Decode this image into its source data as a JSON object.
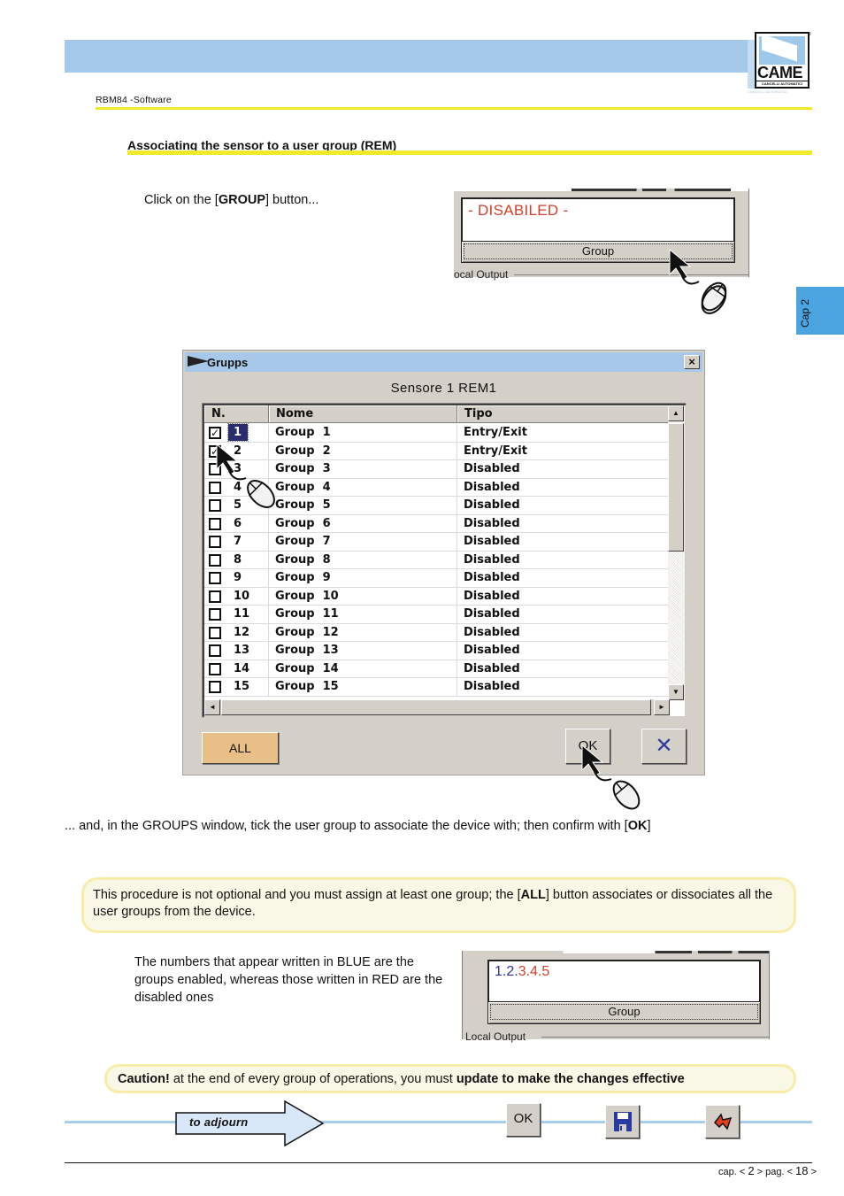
{
  "header": {
    "doc_id": "RBM84 -Software",
    "logo": {
      "brand": "CAME",
      "tagline": "CANCELLI AUTOMATICI",
      "registered": "®"
    },
    "section_title": "Associating the sensor to a user group (REM)",
    "chapter_tab": "Cap 2"
  },
  "step1": {
    "text_before": "Click on the [",
    "bold": "GROUP",
    "text_after": "] button..."
  },
  "panel_disabled": {
    "status_text": "- DISABILED -",
    "status_color": "#d2402a",
    "button_label": "Group",
    "frame_label": "ocal Output"
  },
  "dialog": {
    "title": "Grupps",
    "close_label": "×",
    "heading": "Sensore 1 REM1",
    "columns": [
      "N.",
      "Nome",
      "Tipo"
    ],
    "rows": [
      {
        "checked": true,
        "n": "1",
        "nome": "Group  1",
        "tipo": "Entry/Exit",
        "selected": true
      },
      {
        "checked": true,
        "n": "2",
        "nome": "Group  2",
        "tipo": "Entry/Exit"
      },
      {
        "checked": false,
        "n": "3",
        "nome": "Group  3",
        "tipo": "Disabled"
      },
      {
        "checked": false,
        "n": "4",
        "nome": "Group  4",
        "tipo": "Disabled"
      },
      {
        "checked": false,
        "n": "5",
        "nome": "Group  5",
        "tipo": "Disabled"
      },
      {
        "checked": false,
        "n": "6",
        "nome": "Group  6",
        "tipo": "Disabled"
      },
      {
        "checked": false,
        "n": "7",
        "nome": "Group  7",
        "tipo": "Disabled"
      },
      {
        "checked": false,
        "n": "8",
        "nome": "Group  8",
        "tipo": "Disabled"
      },
      {
        "checked": false,
        "n": "9",
        "nome": "Group  9",
        "tipo": "Disabled"
      },
      {
        "checked": false,
        "n": "10",
        "nome": "Group  10",
        "tipo": "Disabled"
      },
      {
        "checked": false,
        "n": "11",
        "nome": "Group  11",
        "tipo": "Disabled"
      },
      {
        "checked": false,
        "n": "12",
        "nome": "Group  12",
        "tipo": "Disabled"
      },
      {
        "checked": false,
        "n": "13",
        "nome": "Group  13",
        "tipo": "Disabled"
      },
      {
        "checked": false,
        "n": "14",
        "nome": "Group  14",
        "tipo": "Disabled"
      },
      {
        "checked": false,
        "n": "15",
        "nome": "Group  15",
        "tipo": "Disabled"
      }
    ],
    "all_button": "ALL",
    "ok_button": "OK",
    "cancel_button": "✕",
    "all_button_color": "#e8bf86"
  },
  "instructions": {
    "groups_text_before": "... and, in the GROUPS window, tick the user group to associate the device with; then confirm with [",
    "groups_text_bold": "OK",
    "groups_text_after": "]",
    "note_before": " This procedure is not optional and you must assign at least one group; the [",
    "note_bold": "ALL",
    "note_after": "] button associates or dissociates all the user groups from the device.",
    "blue_red_text": "The numbers that appear written in BLUE are the groups enabled, whereas those written in RED are the disabled ones"
  },
  "panel_numbers": {
    "enabled": [
      "1",
      "2"
    ],
    "disabled": [
      "3",
      "4",
      "5"
    ],
    "separator": ".",
    "enabled_color": "#2a3590",
    "disabled_color": "#d2402a",
    "button_label": "Group",
    "frame_label": "Local Output"
  },
  "caution": {
    "bold_lead": "Caution!",
    "middle": " at the end of every group of operations, you must ",
    "bold_tail": "update to make the changes effective"
  },
  "nav": {
    "adjourn_label": "to adjourn",
    "ok_label": "OK",
    "save_icon": "floppy-disk-icon",
    "exit_icon": "exit-arrow-icon"
  },
  "footer": {
    "cap_prefix": "cap. < ",
    "cap": "2",
    "pag_prefix": " > pag. < ",
    "pag": "18",
    "suffix": " >"
  }
}
